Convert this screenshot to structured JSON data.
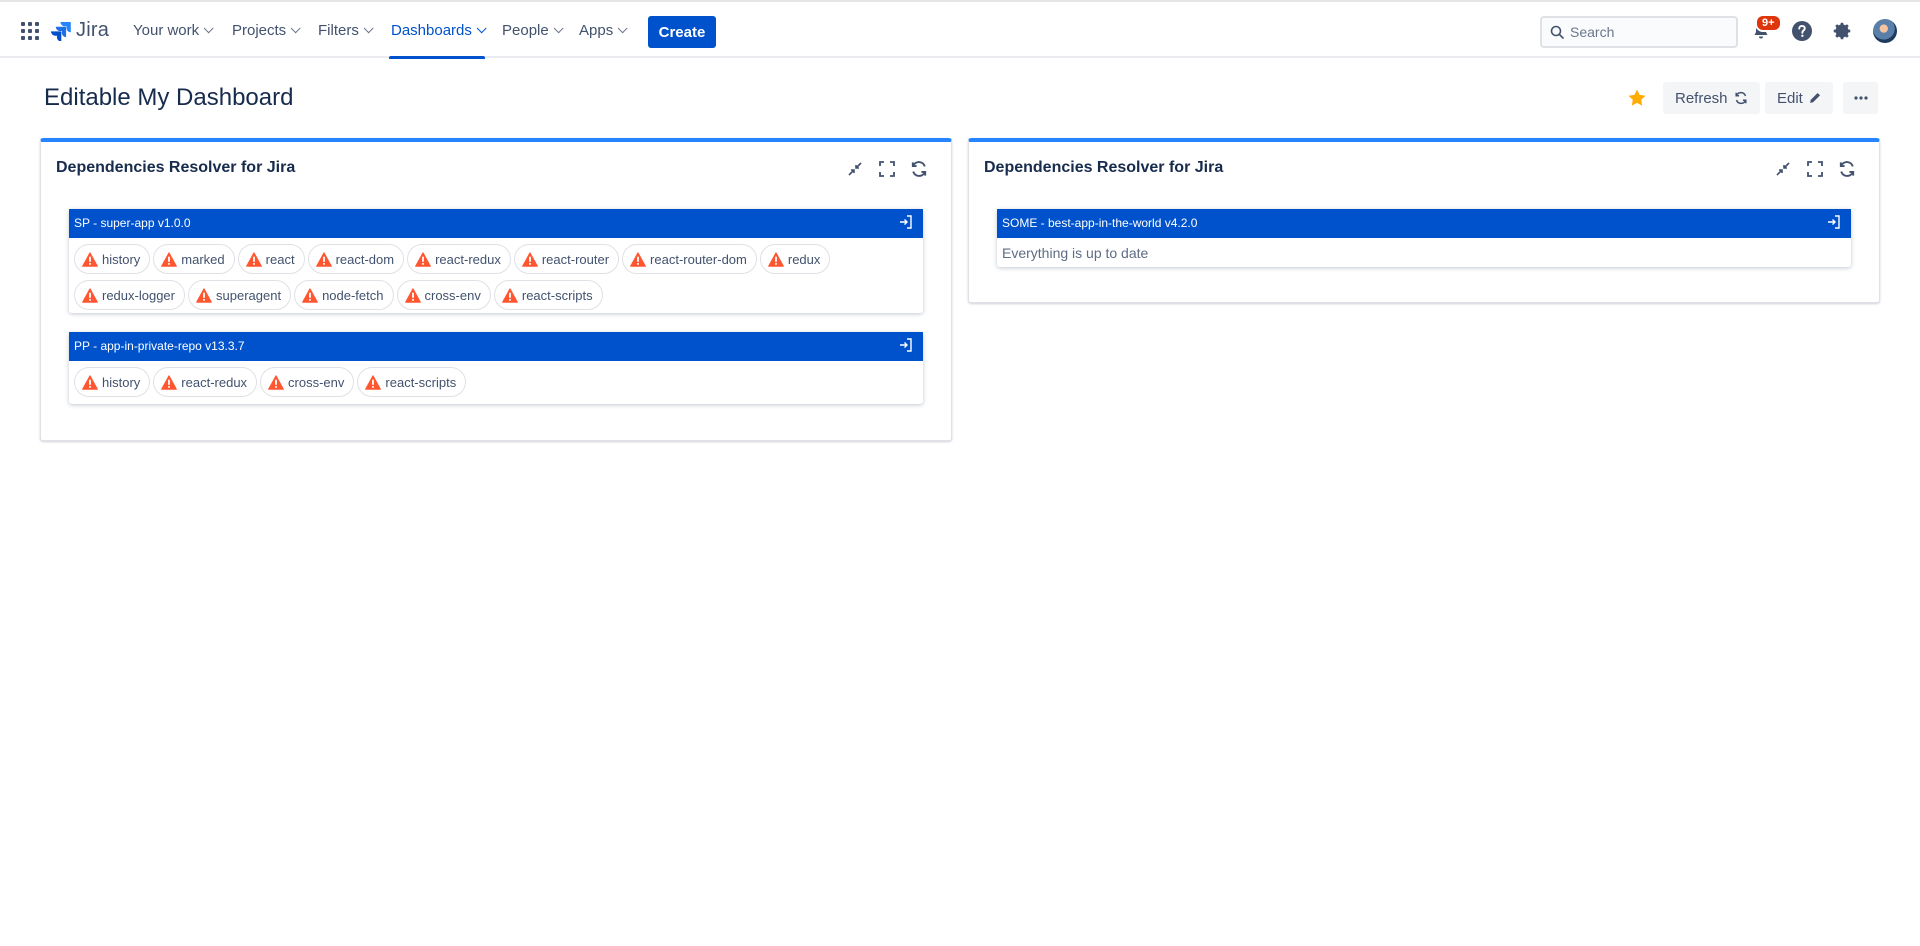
{
  "nav": {
    "logo": "Jira",
    "items": [
      {
        "label": "Your work"
      },
      {
        "label": "Projects"
      },
      {
        "label": "Filters"
      },
      {
        "label": "Dashboards"
      },
      {
        "label": "People"
      },
      {
        "label": "Apps"
      }
    ],
    "active_item": "Dashboards",
    "create_label": "Create",
    "search_placeholder": "Search",
    "notifications_badge": "9+"
  },
  "page": {
    "title": "Editable My Dashboard",
    "refresh_label": "Refresh",
    "edit_label": "Edit"
  },
  "colors": {
    "primary": "#0052cc",
    "gadget_accent": "#2684ff",
    "warning": "#ff5630",
    "star": "#ffab00"
  },
  "gadgets": [
    {
      "title": "Dependencies Resolver for Jira",
      "apps": [
        {
          "header": "SP - super-app v1.0.0",
          "dependencies": [
            "history",
            "marked",
            "react",
            "react-dom",
            "react-redux",
            "react-router",
            "react-router-dom",
            "redux",
            "redux-logger",
            "superagent",
            "node-fetch",
            "cross-env",
            "react-scripts"
          ]
        },
        {
          "header": "PP - app-in-private-repo v13.3.7",
          "dependencies": [
            "history",
            "react-redux",
            "cross-env",
            "react-scripts"
          ]
        }
      ]
    },
    {
      "title": "Dependencies Resolver for Jira",
      "apps": [
        {
          "header": "SOME - best-app-in-the-world v4.2.0",
          "status": "Everything is up to date"
        }
      ]
    }
  ],
  "icons": {
    "app_switcher": "grid-icon",
    "notifications": "bell-icon",
    "help": "help-icon",
    "settings": "gear-icon",
    "favourite": "star-icon",
    "gadget_tools": [
      "minimize-icon",
      "fullscreen-icon",
      "refresh-icon"
    ],
    "dependency": "warning-icon",
    "open": "open-in-icon"
  }
}
